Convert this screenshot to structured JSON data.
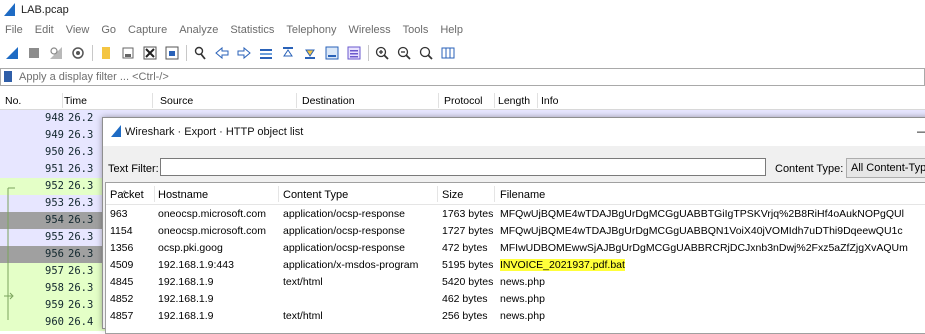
{
  "window": {
    "title": "LAB.pcap"
  },
  "menu": [
    "File",
    "Edit",
    "View",
    "Go",
    "Capture",
    "Analyze",
    "Statistics",
    "Telephony",
    "Wireless",
    "Tools",
    "Help"
  ],
  "filter": {
    "placeholder": "Apply a display filter ... <Ctrl-/>"
  },
  "packet_list": {
    "columns": [
      "No.",
      "Time",
      "Source",
      "Destination",
      "Protocol",
      "Length",
      "Info"
    ],
    "rows": [
      {
        "no": "948",
        "time": "26.2"
      },
      {
        "no": "949",
        "time": "26.3"
      },
      {
        "no": "950",
        "time": "26.3"
      },
      {
        "no": "951",
        "time": "26.3"
      },
      {
        "no": "952",
        "time": "26.3"
      },
      {
        "no": "953",
        "time": "26.3"
      },
      {
        "no": "954",
        "time": "26.3"
      },
      {
        "no": "955",
        "time": "26.3"
      },
      {
        "no": "956",
        "time": "26.3"
      },
      {
        "no": "957",
        "time": "26.3"
      },
      {
        "no": "958",
        "time": "26.3"
      },
      {
        "no": "959",
        "time": "26.3"
      },
      {
        "no": "960",
        "time": "26.4"
      }
    ],
    "row_colors": [
      "#e7e6ff",
      "#e7e6ff",
      "#e7e6ff",
      "#e7e6ff",
      "#e4ffc7",
      "#e7e6ff",
      "#a0a0a0",
      "#e7e6ff",
      "#a0a0a0",
      "#e4ffc7",
      "#e4ffc7",
      "#e4ffc7",
      "#e4ffc7"
    ]
  },
  "dialog": {
    "title": "Wireshark · Export · HTTP object list",
    "minimize_glyph": "—",
    "text_filter_label": "Text Filter:",
    "text_filter_value": "",
    "content_type_label": "Content Type:",
    "content_type_value": "All Content-Types",
    "columns": [
      "Packet",
      "Hostname",
      "Content Type",
      "Size",
      "Filename"
    ],
    "rows": [
      {
        "packet": "963",
        "hostname": "oneocsp.microsoft.com",
        "content_type": "application/ocsp-response",
        "size": "1763 bytes",
        "filename": "MFQwUjBQME4wTDAJBgUrDgMCGgUABBTGiIgTPSKVrjq%2B8RiHf4oAukNOPgQUl"
      },
      {
        "packet": "1154",
        "hostname": "oneocsp.microsoft.com",
        "content_type": "application/ocsp-response",
        "size": "1727 bytes",
        "filename": "MFQwUjBQME4wTDAJBgUrDgMCGgUABBQN1VoiX40jVOMIdh7uDThi9DqeewQU1c"
      },
      {
        "packet": "1356",
        "hostname": "ocsp.pki.goog",
        "content_type": "application/ocsp-response",
        "size": "472 bytes",
        "filename": "MFIwUDBOMEwwSjAJBgUrDgMCGgUABBRCRjDCJxnb3nDwj%2Fxz5aZfZjgXvAQUm"
      },
      {
        "packet": "4509",
        "hostname": "192.168.1.9:443",
        "content_type": "application/x-msdos-program",
        "size": "5195 bytes",
        "filename": "INVOICE_2021937.pdf.bat",
        "highlight": true
      },
      {
        "packet": "4845",
        "hostname": "192.168.1.9",
        "content_type": "text/html",
        "size": "5420 bytes",
        "filename": "news.php"
      },
      {
        "packet": "4852",
        "hostname": "192.168.1.9",
        "content_type": "",
        "size": "462 bytes",
        "filename": "news.php"
      },
      {
        "packet": "4857",
        "hostname": "192.168.1.9",
        "content_type": "text/html",
        "size": "256 bytes",
        "filename": "news.php"
      }
    ]
  },
  "colors": {
    "accent": "#1e6bc4",
    "highlight": "#ffff3a"
  },
  "icons": [
    "shark-fin-start-icon",
    "stop-icon",
    "restart-icon",
    "options-icon",
    "open-file-icon",
    "save-icon",
    "close-file-icon",
    "reload-icon",
    "find-icon",
    "back-icon",
    "forward-icon",
    "goto-icon",
    "first-icon",
    "last-icon",
    "autoscroll-icon",
    "colorize-icon",
    "zoom-in-icon",
    "zoom-out-icon",
    "zoom-reset-icon",
    "resize-columns-icon"
  ]
}
